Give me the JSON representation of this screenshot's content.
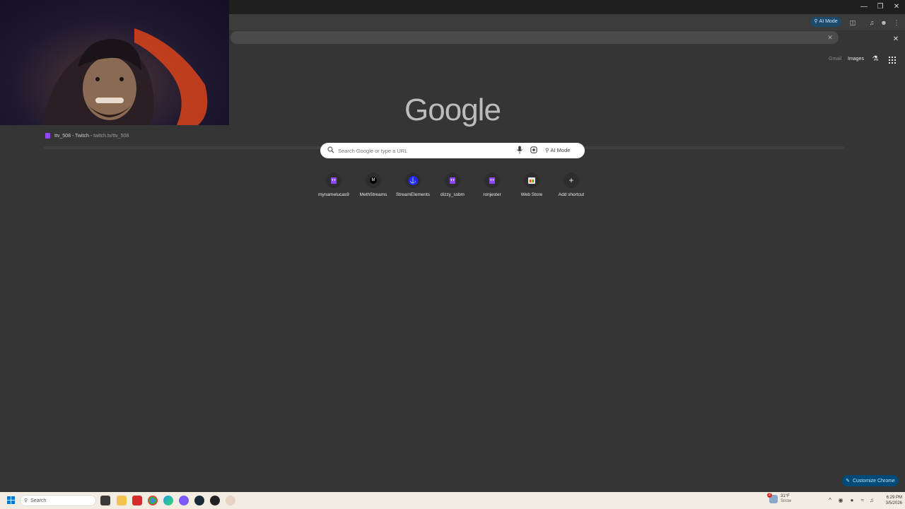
{
  "toolbar": {
    "ai_mode_label": "AI Mode"
  },
  "omnibox": {
    "suggestion_title": "ttv_508 - Twitch",
    "suggestion_sep": " - ",
    "suggestion_url": "twitch.tv/ttv_508"
  },
  "ntp": {
    "gmail": "Gmail",
    "images": "Images",
    "logo": "Google",
    "search_placeholder": "Search Google or type a URL",
    "ai_mode": "AI Mode",
    "shortcuts": [
      {
        "label": "mynamelucas9",
        "icon": "twitch-icon"
      },
      {
        "label": "MethStreams",
        "icon": "methstreams-icon"
      },
      {
        "label": "StreamElements",
        "icon": "streamelements-icon"
      },
      {
        "label": "dizzy_ssbm",
        "icon": "twitch-icon"
      },
      {
        "label": "ronjester",
        "icon": "twitch-icon"
      },
      {
        "label": "Web Store",
        "icon": "web-store-icon"
      },
      {
        "label": "Add shortcut",
        "icon": "plus-icon"
      }
    ],
    "customize": "Customize Chrome"
  },
  "taskbar": {
    "search_placeholder": "Search",
    "weather_temp": "31°F",
    "weather_cond": "Snow",
    "weather_badge": "2",
    "time": "6:29 PM",
    "date": "3/5/2026"
  },
  "colors": {
    "accent": "#004a77",
    "twitch": "#9146ff",
    "taskbar": "#f3ece2"
  }
}
